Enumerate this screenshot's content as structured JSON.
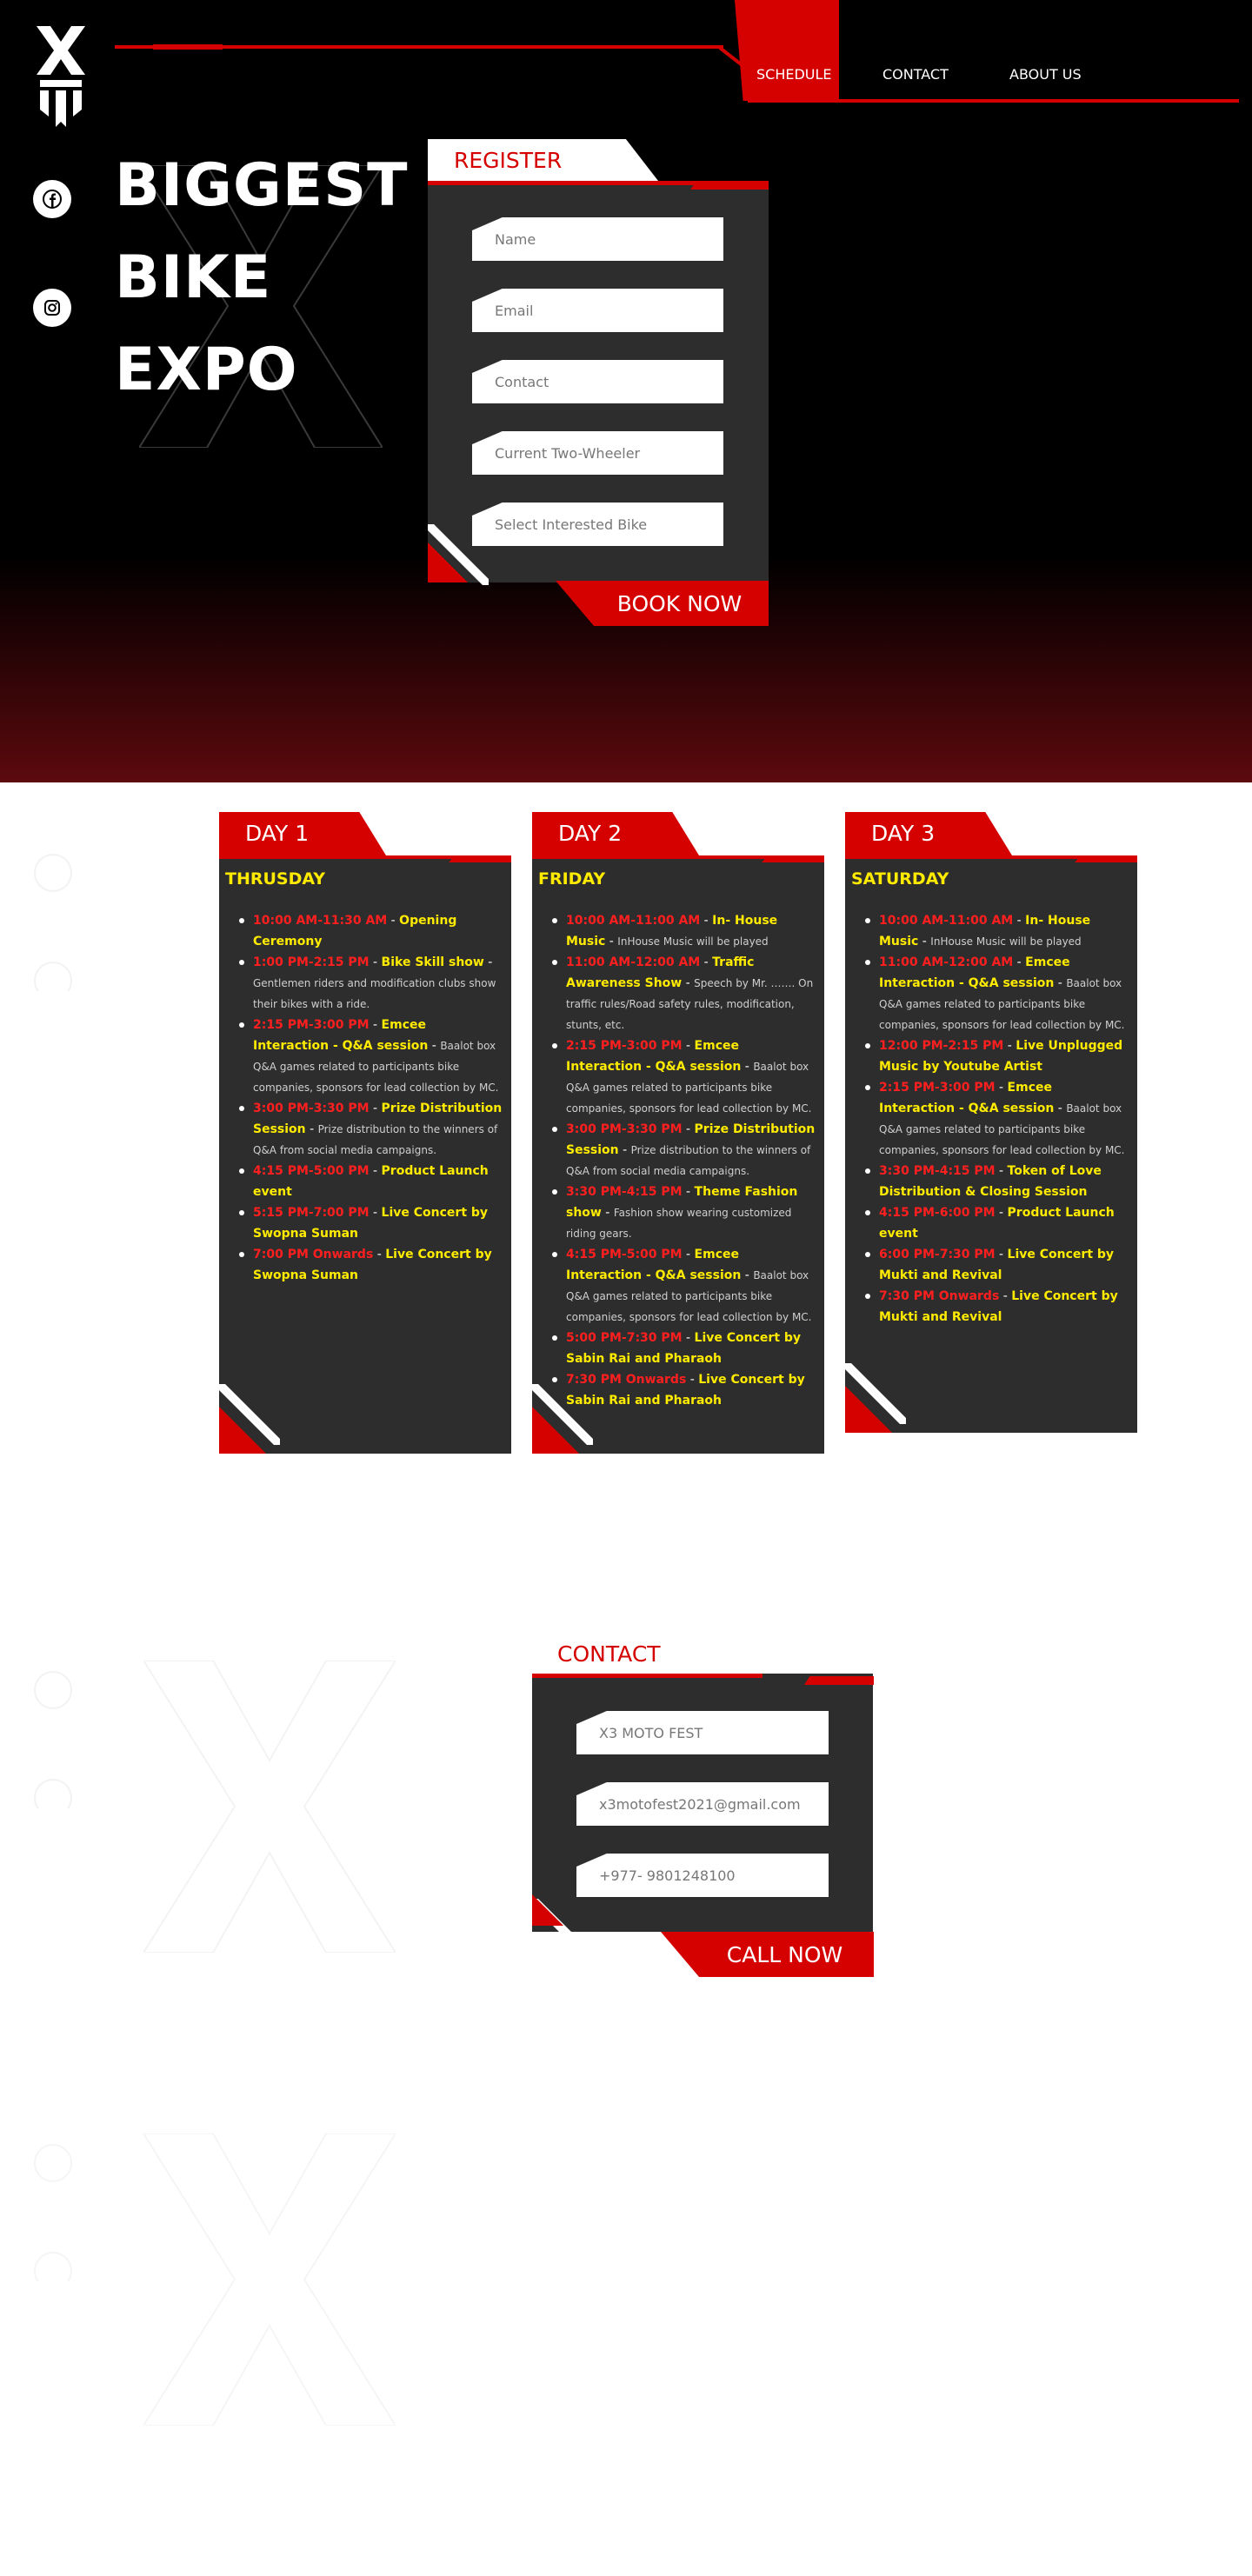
{
  "nav": {
    "items": [
      "SCHEDULE",
      "CONTACT",
      "ABOUT US"
    ]
  },
  "hero": {
    "headline": [
      "BIGGEST",
      "BIKE",
      "EXPO"
    ]
  },
  "register": {
    "title": "REGISTER",
    "fields": [
      "Name",
      "Email",
      "Contact",
      "Current Two-Wheeler",
      "Select Interested Bike"
    ],
    "button": "BOOK NOW"
  },
  "schedule": {
    "days": [
      {
        "tab": "DAY 1",
        "name": "THRUSDAY",
        "events": [
          {
            "time": "10:00 AM-11:30 AM",
            "title": "Opening Ceremony",
            "desc": ""
          },
          {
            "time": "1:00 PM-2:15 PM",
            "title": "Bike Skill show",
            "desc": "Gentlemen riders and modification clubs show their bikes with a ride."
          },
          {
            "time": "2:15 PM-3:00 PM",
            "title": "Emcee Interaction - Q&A session",
            "desc": "Baalot box Q&A games related to participants bike companies, sponsors for lead collection by MC."
          },
          {
            "time": "3:00 PM-3:30 PM",
            "title": "Prize Distribution Session",
            "desc": "Prize distribution to the winners of Q&A from social media campaigns."
          },
          {
            "time": "4:15 PM-5:00 PM",
            "title": "Product Launch event",
            "desc": ""
          },
          {
            "time": "5:15 PM-7:00 PM",
            "title": "Live Concert by Swopna Suman",
            "desc": ""
          },
          {
            "time": "7:00 PM Onwards",
            "title": "Live Concert by Swopna Suman",
            "desc": ""
          }
        ]
      },
      {
        "tab": "DAY 2",
        "name": "FRIDAY",
        "events": [
          {
            "time": "10:00 AM-11:00 AM",
            "title": "In- House Music",
            "desc": "InHouse Music will be played"
          },
          {
            "time": "11:00 AM-12:00 AM",
            "title": "Traffic Awareness Show",
            "desc": "Speech by Mr. ……. On traffic rules/Road safety rules, modification, stunts, etc."
          },
          {
            "time": "2:15 PM-3:00 PM",
            "title": "Emcee Interaction - Q&A session",
            "desc": "Baalot box Q&A games related to participants bike companies, sponsors for lead collection by MC."
          },
          {
            "time": "3:00 PM-3:30 PM",
            "title": "Prize Distribution Session",
            "desc": "Prize distribution to the winners of Q&A from social media campaigns."
          },
          {
            "time": "3:30 PM-4:15 PM",
            "title": "Theme Fashion show",
            "desc": "Fashion show wearing customized riding gears."
          },
          {
            "time": "4:15 PM-5:00 PM",
            "title": "Emcee Interaction - Q&A session",
            "desc": "Baalot box Q&A games related to participants bike companies, sponsors for lead collection by MC."
          },
          {
            "time": "5:00 PM-7:30 PM",
            "title": "Live Concert by Sabin Rai and Pharaoh",
            "desc": ""
          },
          {
            "time": "7:30 PM Onwards",
            "title": "Live Concert by Sabin Rai and Pharaoh",
            "desc": ""
          }
        ]
      },
      {
        "tab": "DAY 3",
        "name": "SATURDAY",
        "events": [
          {
            "time": "10:00 AM-11:00 AM",
            "title": "In- House Music",
            "desc": "InHouse Music will be played"
          },
          {
            "time": "11:00 AM-12:00 AM",
            "title": "Emcee Interaction - Q&A session",
            "desc": "Baalot box Q&A games related to participants bike companies, sponsors for lead collection by MC."
          },
          {
            "time": "12:00 PM-2:15 PM",
            "title": "Live Unplugged Music by Youtube Artist",
            "desc": ""
          },
          {
            "time": "2:15 PM-3:00 PM",
            "title": "Emcee Interaction - Q&A session",
            "desc": "Baalot box Q&A games related to participants bike companies, sponsors for lead collection by MC."
          },
          {
            "time": "3:30 PM-4:15 PM",
            "title": "Token of Love Distribution & Closing Session",
            "desc": ""
          },
          {
            "time": "4:15 PM-6:00 PM",
            "title": "Product Launch event",
            "desc": ""
          },
          {
            "time": "6:00 PM-7:30 PM",
            "title": "Live Concert by Mukti and Revival",
            "desc": ""
          },
          {
            "time": "7:30 PM Onwards",
            "title": "Live Concert by Mukti and Revival",
            "desc": ""
          }
        ]
      }
    ]
  },
  "contact": {
    "title": "CONTACT",
    "fields": [
      "X3 MOTO FEST",
      "x3motofest2021@gmail.com",
      "+977- 9801248100"
    ],
    "button": "CALL NOW"
  },
  "icons": {
    "social": [
      "facebook-icon",
      "instagram-icon"
    ]
  },
  "colors": {
    "brand_red": "#d50000",
    "highlight_yellow": "#ffeb00",
    "card_dark": "#2d2d2d"
  }
}
